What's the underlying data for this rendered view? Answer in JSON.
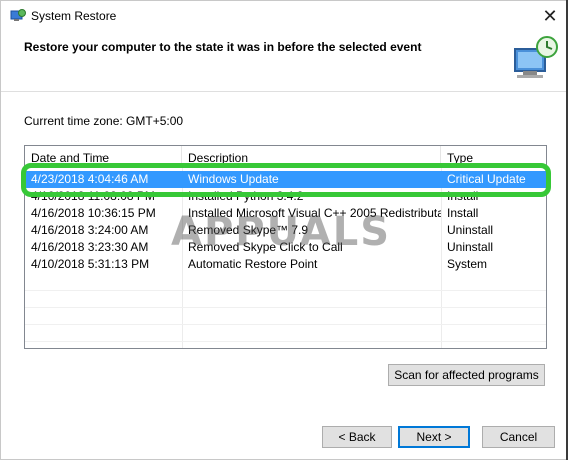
{
  "window": {
    "title": "System Restore"
  },
  "heading": "Restore your computer to the state it was in before the selected event",
  "timezone": "Current time zone: GMT+5:00",
  "table": {
    "columns": [
      "Date and Time",
      "Description",
      "Type"
    ],
    "rows": [
      [
        "4/23/2018 4:04:46 AM",
        "Windows Update",
        "Critical Update"
      ],
      [
        "4/16/2018 11:08:08 PM",
        "Installed Python 3.4.2",
        "Install"
      ],
      [
        "4/16/2018 10:36:15 PM",
        "Installed Microsoft Visual C++ 2005 Redistributa...",
        "Install"
      ],
      [
        "4/16/2018 3:24:00 AM",
        "Removed Skype™ 7.9",
        "Uninstall"
      ],
      [
        "4/16/2018 3:23:30 AM",
        "Removed Skype Click to Call",
        "Uninstall"
      ],
      [
        "4/10/2018 5:31:13 PM",
        "Automatic Restore Point",
        "System"
      ]
    ],
    "selected_index": 0
  },
  "watermark": "APPUALS",
  "buttons": {
    "scan": "Scan for affected programs",
    "back": "< Back",
    "next": "Next >",
    "cancel": "Cancel"
  },
  "colors": {
    "selection": "#3399ff",
    "highlight_ring": "#37c837",
    "default_button_border": "#0078d7"
  }
}
